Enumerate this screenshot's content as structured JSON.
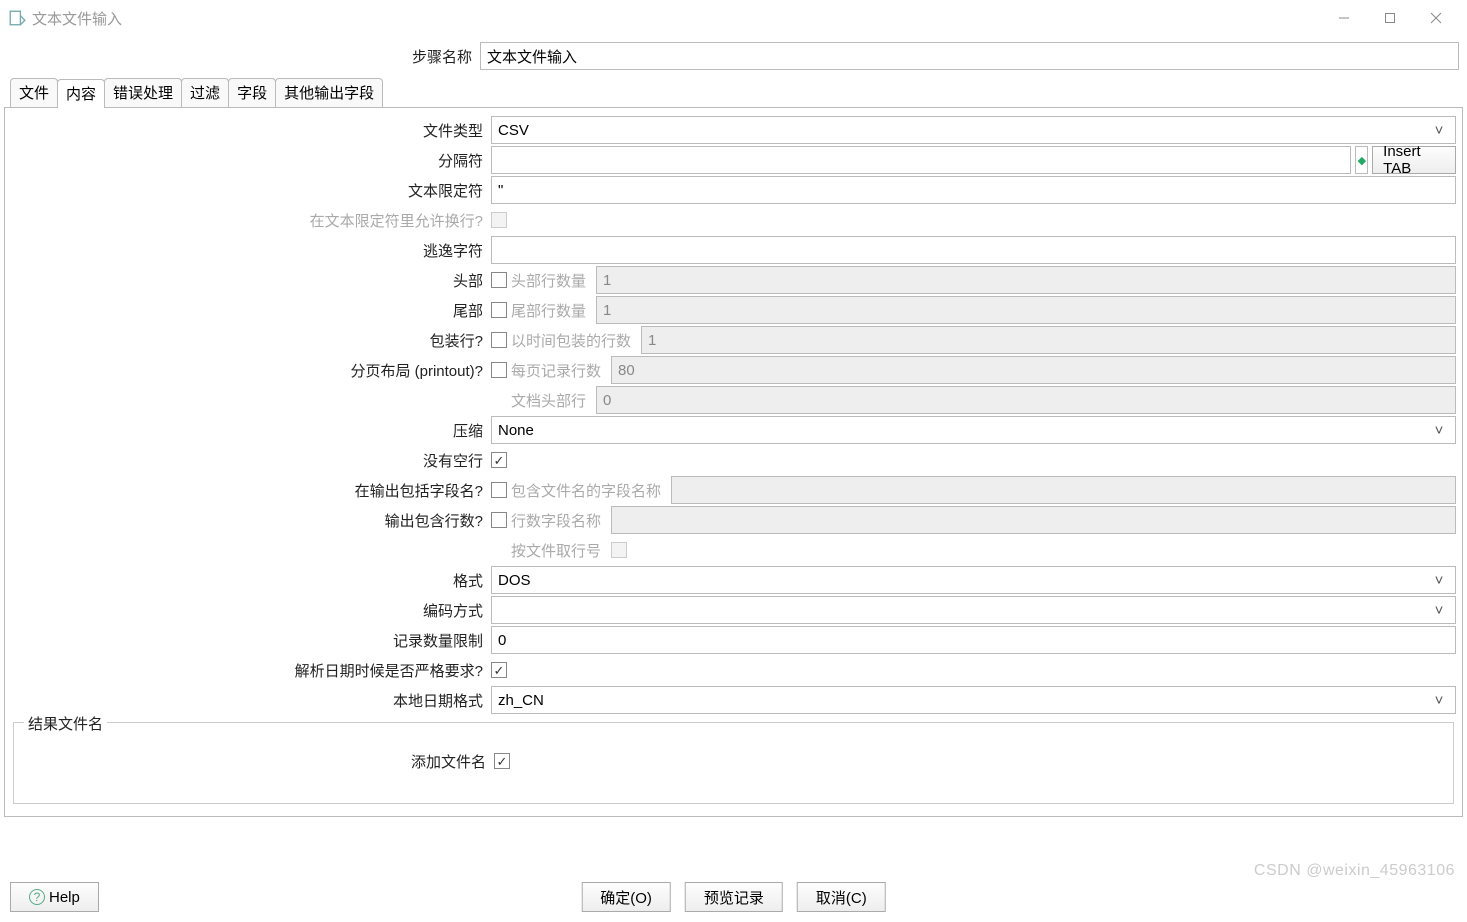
{
  "window": {
    "title": "文本文件输入"
  },
  "stepName": {
    "label": "步骤名称",
    "value": "文本文件输入"
  },
  "tabs": [
    "文件",
    "内容",
    "错误处理",
    "过滤",
    "字段",
    "其他输出字段"
  ],
  "content": {
    "fileType": {
      "label": "文件类型",
      "value": "CSV"
    },
    "separator": {
      "label": "分隔符",
      "value": "",
      "insertTab": "Insert TAB"
    },
    "textQualifier": {
      "label": "文本限定符",
      "value": "\""
    },
    "allowNewline": {
      "label": "在文本限定符里允许换行?",
      "checked": false
    },
    "escapeChar": {
      "label": "逃逸字符",
      "value": ""
    },
    "header": {
      "label": "头部",
      "checked": false,
      "sublabel": "头部行数量",
      "value": "1"
    },
    "footer": {
      "label": "尾部",
      "checked": false,
      "sublabel": "尾部行数量",
      "value": "1"
    },
    "wrapped": {
      "label": "包装行?",
      "checked": false,
      "sublabel": "以时间包装的行数",
      "value": "1"
    },
    "paged": {
      "label": "分页布局 (printout)?",
      "checked": false,
      "sublabel": "每页记录行数",
      "value": "80"
    },
    "docHeader": {
      "sublabel": "文档头部行",
      "value": "0"
    },
    "compression": {
      "label": "压缩",
      "value": "None"
    },
    "noEmptyLines": {
      "label": "没有空行",
      "checked": true
    },
    "includeFieldName": {
      "label": "在输出包括字段名?",
      "checked": false,
      "sublabel": "包含文件名的字段名称",
      "value": ""
    },
    "includeRowNum": {
      "label": "输出包含行数?",
      "checked": false,
      "sublabel": "行数字段名称",
      "value": ""
    },
    "rowNumPerFile": {
      "sublabel": "按文件取行号",
      "checked": false
    },
    "format": {
      "label": "格式",
      "value": "DOS"
    },
    "encoding": {
      "label": "编码方式",
      "value": ""
    },
    "rowLimit": {
      "label": "记录数量限制",
      "value": "0"
    },
    "strictDate": {
      "label": "解析日期时候是否严格要求?",
      "checked": true
    },
    "locale": {
      "label": "本地日期格式",
      "value": "zh_CN"
    }
  },
  "resultBox": {
    "legend": "结果文件名",
    "addFilename": {
      "label": "添加文件名",
      "checked": true
    }
  },
  "buttons": {
    "help": "Help",
    "ok": "确定(O)",
    "preview": "预览记录",
    "cancel": "取消(C)"
  },
  "watermark": "CSDN @weixin_45963106"
}
